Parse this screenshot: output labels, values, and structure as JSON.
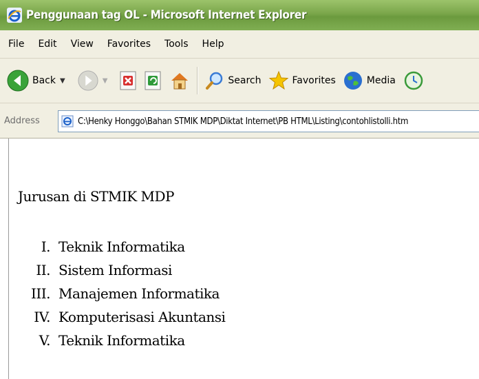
{
  "window": {
    "title": "Penggunaan tag OL - Microsoft Internet Explorer"
  },
  "menu": [
    "File",
    "Edit",
    "View",
    "Favorites",
    "Tools",
    "Help"
  ],
  "toolbar": {
    "back_label": "Back",
    "search_label": "Search",
    "favorites_label": "Favorites",
    "media_label": "Media"
  },
  "address": {
    "label": "Address",
    "url": "C:\\Henky Honggo\\Bahan STMIK MDP\\Diktat Internet\\PB HTML\\Listing\\contohlistolli.htm"
  },
  "page": {
    "heading": "Jurusan di STMIK MDP",
    "list": [
      {
        "num": "I.",
        "text": "Teknik Informatika"
      },
      {
        "num": "II.",
        "text": "Sistem Informasi"
      },
      {
        "num": "III.",
        "text": "Manajemen Informatika"
      },
      {
        "num": "IV.",
        "text": "Komputerisasi Akuntansi"
      },
      {
        "num": "V.",
        "text": "Teknik Informatika"
      }
    ]
  },
  "colors": {
    "titlebar": "#7aa64a",
    "chrome": "#f1efe2"
  }
}
